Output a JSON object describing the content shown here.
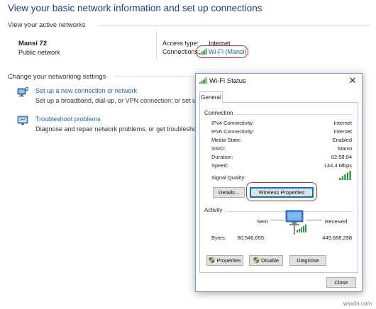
{
  "background": {
    "title": "View your basic network information and set up connections",
    "active_networks_heading": "View your active networks",
    "network": {
      "name": "Mansi 72",
      "type": "Public network"
    },
    "access_type_label": "Access type:",
    "access_type_value": "Internet",
    "connections_label": "Connections:",
    "connection_link": "Wi-Fi (Mansi)",
    "change_settings_heading": "Change your networking settings",
    "settings": [
      {
        "link": "Set up a new connection or network",
        "desc": "Set up a broadband, dial-up, or VPN connection; or set up a r",
        "icon": "network-setup-icon"
      },
      {
        "link": "Troubleshoot problems",
        "desc": "Diagnose and repair network problems, or get troubleshootin",
        "icon": "troubleshoot-icon"
      }
    ]
  },
  "dialog": {
    "title": "Wi-Fi Status",
    "close_glyph": "✕",
    "tab": "General",
    "connection_group": "Connection",
    "rows": [
      {
        "label": "IPv4 Connectivity:",
        "value": "Internet"
      },
      {
        "label": "IPv6 Connectivity:",
        "value": "Internet"
      },
      {
        "label": "Media State:",
        "value": "Enabled"
      },
      {
        "label": "SSID:",
        "value": "Mansi"
      },
      {
        "label": "Duration:",
        "value": "02:58:04"
      },
      {
        "label": "Speed:",
        "value": "144.4 Mbps"
      }
    ],
    "signal_quality_label": "Signal Quality:",
    "signal_quality_bars": 5,
    "details_button": "Details...",
    "wireless_properties_button": "Wireless Properties",
    "activity_group": "Activity",
    "sent_label": "Sent",
    "received_label": "Received",
    "bytes_label": "Bytes:",
    "bytes_sent": "90,546,655",
    "bytes_received": "449,688,298",
    "properties_button": "Properties",
    "disable_button": "Disable",
    "diagnose_button": "Diagnose",
    "close_button": "Close"
  },
  "watermark": "wsxdn.com",
  "colors": {
    "link": "#1565c0",
    "title": "#1e3d8f",
    "highlight_oval": "#d0312d",
    "signal": "#2e9e3b"
  }
}
